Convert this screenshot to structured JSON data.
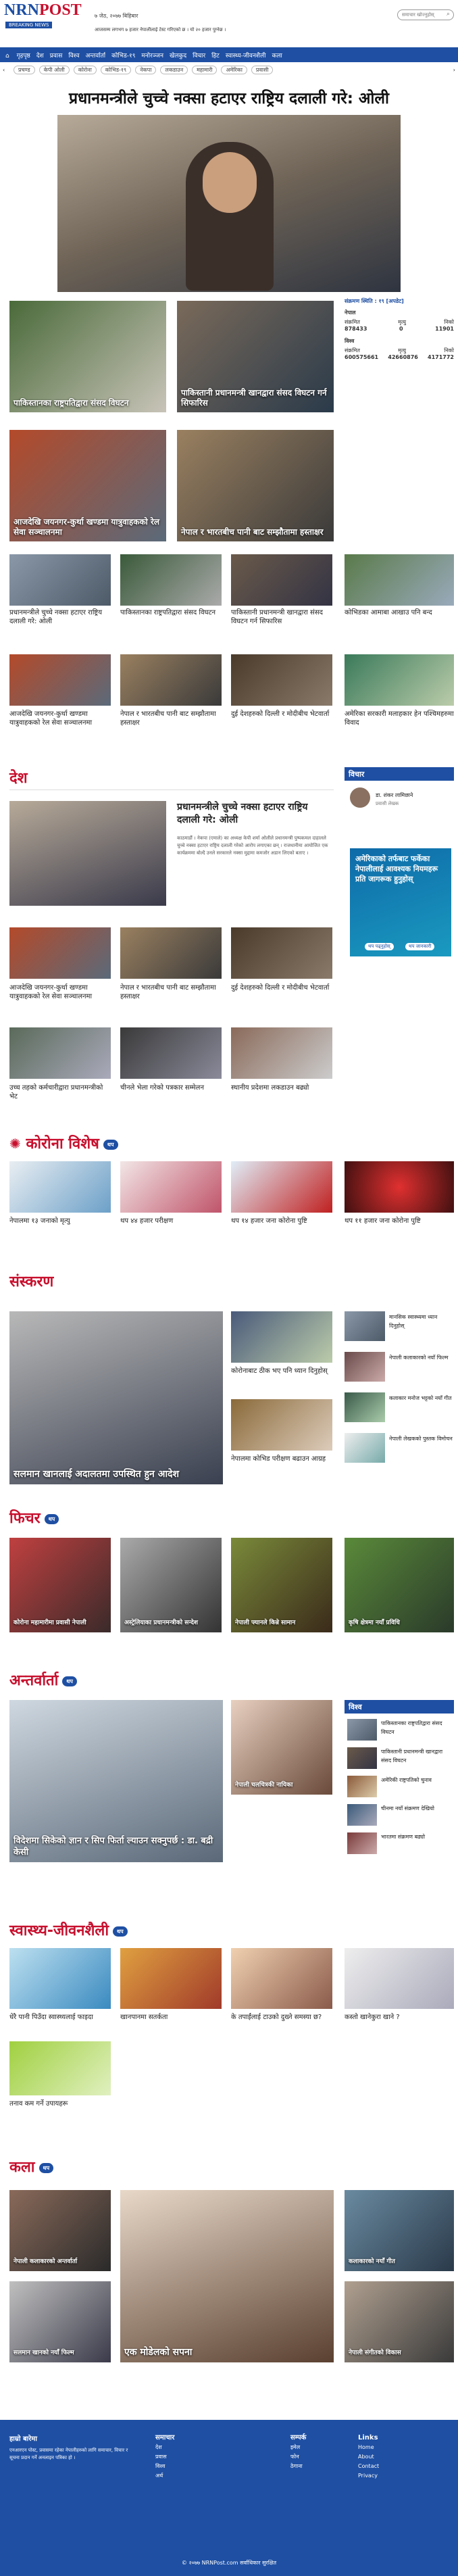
{
  "brand": {
    "logo_a": "NRN",
    "logo_b": "POST",
    "tagline": "BREAKING NEWS",
    "date": "७ जेठ, २०७७ बिहिबार"
  },
  "ticker": "आजसम्म लगभग ७ हजार नेपालीलाई टेस्ट गरिएको छ । यो २० हजार पुग्नेछ ।",
  "search_placeholder": "समाचार खोज्नुहोस्",
  "nav": [
    "गृहपृष्ठ",
    "देश",
    "प्रवास",
    "विश्व",
    "अन्तर्वार्ता",
    "कोभिड-१९",
    "मनोरञ्जन",
    "खेलकुद",
    "विचार",
    "हिट",
    "स्वास्थ्य-जीवनशैली",
    "कला"
  ],
  "tags": [
    "प्रचण्ड",
    "केपी ओली",
    "कोरोना",
    "कोभिड-१९",
    "नेकपा",
    "लकडाउन",
    "महामारी",
    "अमेरिका",
    "प्रवासी"
  ],
  "hero": {
    "title": "प्रधानमन्त्रीले चुच्चे नक्सा हटाएर राष्ट्रिय दलाली गरे: ओली"
  },
  "feature_cards": [
    {
      "cap": "पाकिस्तानका राष्ट्रपतिद्वारा संसद विघटन"
    },
    {
      "cap": "पाकिस्तानी प्रधानमन्त्री खानद्वारा संसद विघटन गर्न सिफारिस"
    },
    {
      "cap": "आजदेखि जयनगर-कुर्था खण्डमा यात्रुवाहकको रेल सेवा सञ्चालनमा"
    },
    {
      "cap": "नेपाल र भारतबीच पानी बाट सम्झौतामा हस्ताक्षर"
    }
  ],
  "covid": {
    "title": "संक्रमण स्थिति : १९ [अपडेट]",
    "nepal": "नेपाल",
    "world": "विश्व",
    "labels": [
      "संक्रमित",
      "मृत्यु",
      "निको"
    ],
    "np": [
      "878433",
      "0",
      "11901"
    ],
    "wd": [
      "600575661",
      "42660876",
      "4171772"
    ]
  },
  "row1": [
    {
      "t": "प्रधानमन्त्रीले चुच्चे नक्सा हटाएर राष्ट्रिय दलाली गरे: ओली"
    },
    {
      "t": "पाकिस्तानका राष्ट्रपतिद्वारा संसद विघटन"
    },
    {
      "t": "पाकिस्तानी प्रधानमन्त्री खानद्वारा संसद विघटन गर्न सिफारिस"
    },
    {
      "t": "कोभिडका आमाबा आखाउ पनि बन्द"
    }
  ],
  "row2": [
    {
      "t": "आजदेखि जयनगर-कुर्था खण्डमा यात्रुवाहकको रेल सेवा सञ्चालनमा"
    },
    {
      "t": "नेपाल र भारतबीच पानी बाट सम्झौतामा हस्ताक्षर"
    },
    {
      "t": "दुई देशहरुको दिल्ली र मोदीबीच भेटवार्ता"
    },
    {
      "t": "अमेरिका सरकारी मलाहकार हेन पश्चिमहरुमा विवाद"
    }
  ],
  "desh": {
    "title": "देश",
    "lead_title": "प्रधानमन्त्रीले चुच्चे नक्सा हटाएर राष्ट्रिय दलाली गरे: ओली",
    "lead_body": "काठमाडौं । नेकपा (एमाले) का अध्यक्ष केपी शर्मा ओलीले प्रधानमन्त्री पुष्पकमल दाहालले चुच्चे नक्सा हटाएर राष्ट्रिय दलाली गरेको आरोप लगाएका छन् । राजधानीमा आयोजित एक कार्यक्रममा बोल्दै उनले सरकारले नक्सा मुद्दामा कमजोर अडान लिएको बताए ।",
    "items": [
      {
        "t": "आजदेखि जयनगर-कुर्था खण्डमा यात्रुवाहकको रेल सेवा सञ्चालनमा"
      },
      {
        "t": "नेपाल र भारतबीच पानी बाट सम्झौतामा हस्ताक्षर"
      },
      {
        "t": "दुई देशहरुको दिल्ली र मोदीबीच भेटवार्ता"
      },
      {
        "t": "उच्च तहको कर्मचारीद्वारा प्रधानमन्त्रीको भेट"
      },
      {
        "t": "चीनले भेला गरेको पत्रकार सम्मेलन"
      },
      {
        "t": "स्थानीय प्रदेशमा लकडाउन बढ्यो"
      }
    ]
  },
  "opinion": {
    "title": "विचार",
    "items": [
      {
        "t": "डा. शंकर लामिछाने"
      },
      {
        "t": "प्रवासी लेखक"
      }
    ],
    "promo": "अमेरिकाको तर्फबाट फर्केका नेपालीलाई आवश्यक नियमहरू प्रति जागरूक हुनुहोस्",
    "btn1": "थप पढ्नुहोस्",
    "btn2": "थप जानकारी"
  },
  "corona": {
    "title": "कोरोना विशेष",
    "items": [
      {
        "t": "नेपालमा १३ जनाको मृत्यु"
      },
      {
        "t": "थप ४४ हजार परीक्षण"
      },
      {
        "t": "थप १४ हजार जना कोरोना पुष्टि"
      },
      {
        "t": "थप ११ हजार जना कोरोना पुष्टि"
      }
    ]
  },
  "sanskaran": {
    "title": "संस्करण",
    "lead": "सलमान खानलाई अदालतमा उपस्थित हुन आदेश",
    "mid": [
      {
        "t": "कोरोनाबाट ठीक भए पनि ध्यान दिनुहोस्"
      },
      {
        "t": "नेपालमा कोभिड परीक्षण बढाउन आग्रह"
      }
    ],
    "side": [
      {
        "t": "मानसिक स्वास्थ्यमा ध्यान दिनुहोस्"
      },
      {
        "t": "नेपाली कलाकारको नयाँ फिल्म"
      },
      {
        "t": "कलाकार मनोज भट्टको नयाँ गीत"
      },
      {
        "t": "नेपाली लेखकको पुस्तक विमोचन"
      }
    ]
  },
  "feature": {
    "title": "फिचर",
    "items": [
      {
        "t": "कोरोना महामारीमा प्रवासी नेपाली"
      },
      {
        "t": "अस्ट्रेलियाका प्रधानमन्त्रीको सन्देश"
      },
      {
        "t": "नेपाली फ्यानले किन्ने सामान"
      },
      {
        "t": "कृषि क्षेत्रमा नयाँ प्रविधि"
      }
    ]
  },
  "interview": {
    "title": "अन्तर्वार्ता",
    "lead": "विदेशमा सिकेको ज्ञान र सिप फिर्ता ल्याउन सक्नुपर्छ : डा. बद्री केसी",
    "mid": "नेपाली चलचित्रकी नायिका"
  },
  "world": {
    "title": "विश्व",
    "items": [
      {
        "t": "पाकिस्तानका राष्ट्रपतिद्वारा संसद विघटन"
      },
      {
        "t": "पाकिस्तानी प्रधानमन्त्री खानद्वारा संसद विघटन"
      },
      {
        "t": "अमेरिकी राष्ट्रपतिको चुनाव"
      },
      {
        "t": "चीनमा नयाँ संक्रमण देखियो"
      },
      {
        "t": "भारतमा संक्रमण बढ्यो"
      }
    ]
  },
  "health": {
    "title": "स्वास्थ्य-जीवनशैली",
    "items": [
      {
        "t": "धेरै पानी पिउँदा स्वास्थ्यलाई फाइदा"
      },
      {
        "t": "खानपानमा सतर्कता"
      },
      {
        "t": "के तपाईंलाई टाउको दुख्ने समस्या छ?"
      },
      {
        "t": "कस्तो खानेकुरा खाने ?"
      },
      {
        "t": "तनाव कम गर्ने उपायहरू"
      }
    ]
  },
  "kala": {
    "title": "कला",
    "lead": "एक मोडेलको सपना",
    "side": [
      {
        "t": "कलाकारको नयाँ गीत"
      },
      {
        "t": "नेपाली संगीतको विकास"
      }
    ],
    "left": [
      {
        "t": "नेपाली कलाकारको अन्तर्वार्ता"
      },
      {
        "t": "सलमान खानको नयाँ फिल्म"
      }
    ]
  },
  "footer": {
    "about_title": "हाम्रो बारेमा",
    "about": "एनआरएन पोस्ट, प्रवासमा रहेका नेपालीहरुको लागि समाचार, विचार र सूचना प्रदान गर्ने अनलाइन पत्रिका हो ।",
    "col2_title": "समाचार",
    "col2": [
      "देश",
      "प्रवास",
      "विश्व",
      "अर्थ"
    ],
    "col3_title": "सम्पर्क",
    "col3": [
      "इमेल",
      "फोन",
      "ठेगाना"
    ],
    "col4_title": "Links",
    "col4": [
      "Home",
      "About",
      "Contact",
      "Privacy"
    ],
    "copy": "© २०७७ NRNPost.com सर्वाधिकार सुरक्षित"
  },
  "colors": {
    "blue": "#1e4fa3",
    "red": "#c8102e"
  }
}
